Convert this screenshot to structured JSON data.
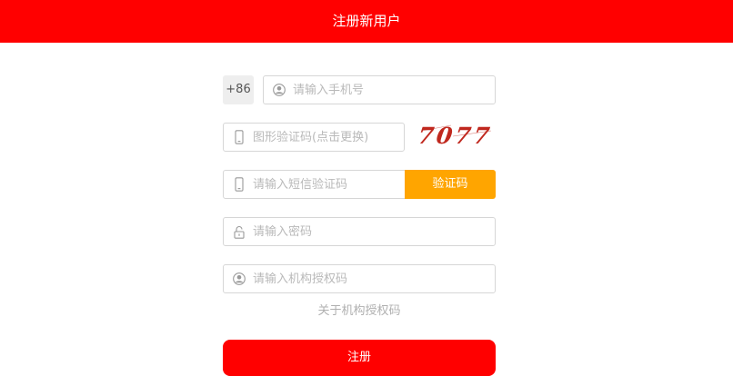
{
  "header": {
    "title": "注册新用户"
  },
  "form": {
    "country_code": "+86",
    "phone": {
      "placeholder": "请输入手机号",
      "value": "",
      "icon": "user-icon"
    },
    "image_captcha": {
      "placeholder": "图形验证码(点击更换)",
      "value": "",
      "icon": "phone-icon",
      "code_text": "7077"
    },
    "sms_code": {
      "placeholder": "请输入短信验证码",
      "value": "",
      "icon": "phone-icon",
      "button_label": "验证码"
    },
    "password": {
      "placeholder": "请输入密码",
      "value": "",
      "icon": "lock-icon"
    },
    "auth_code": {
      "placeholder": "请输入机构授权码",
      "value": "",
      "icon": "user-icon"
    },
    "about_link": "关于机构授权码",
    "submit_label": "注册"
  },
  "colors": {
    "primary": "#ff0000",
    "accent": "#ffa500",
    "captcha_text": "#c0281e",
    "placeholder": "#b9b9b9"
  }
}
